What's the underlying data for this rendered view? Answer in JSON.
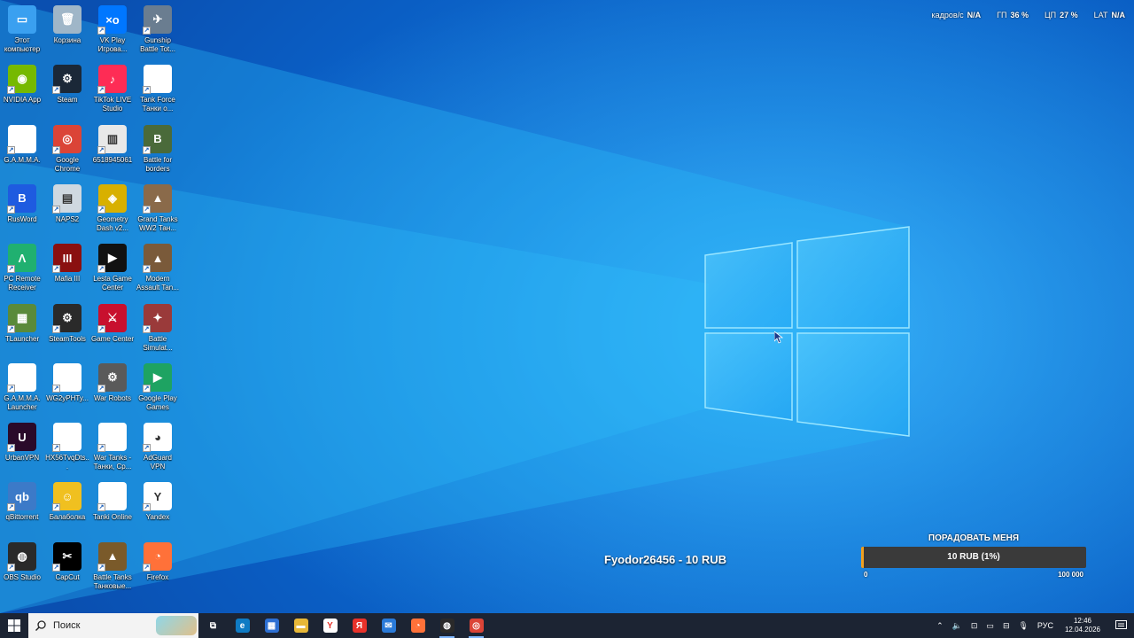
{
  "desktop": {
    "icons": [
      {
        "label": "Этот компьютер",
        "icon": "this-pc-icon",
        "color": "#3aa0f0",
        "glyph": "▭"
      },
      {
        "label": "Корзина",
        "icon": "recycle-bin-icon",
        "color": "#9fb6c8",
        "glyph": "🗑"
      },
      {
        "label": "VK Play Игрова...",
        "icon": "vk-play-icon",
        "color": "#0077ff",
        "glyph": "×o"
      },
      {
        "label": "Gunship Battle Tot...",
        "icon": "gunship-battle-icon",
        "color": "#6a7d90",
        "glyph": "✈"
      },
      {
        "label": "NVIDIA App",
        "icon": "nvidia-icon",
        "color": "#76b900",
        "glyph": "◉"
      },
      {
        "label": "Steam",
        "icon": "steam-icon",
        "color": "#1b2838",
        "glyph": "⚙"
      },
      {
        "label": "TikTok LIVE Studio",
        "icon": "tiktok-icon",
        "color": "#fe2c55",
        "glyph": "♪"
      },
      {
        "label": "Tank Force Танки о...",
        "icon": "file-icon",
        "color": "#ffffff",
        "glyph": ""
      },
      {
        "label": "G.A.M.M.A.",
        "icon": "file-icon",
        "color": "#ffffff",
        "glyph": ""
      },
      {
        "label": "Google Chrome",
        "icon": "chrome-icon",
        "color": "#db4437",
        "glyph": "◎"
      },
      {
        "label": "6518945061",
        "icon": "app-icon",
        "color": "#e8e8e8",
        "glyph": "▥"
      },
      {
        "label": "Battle for borders",
        "icon": "battle-borders-icon",
        "color": "#4a6a3a",
        "glyph": "B"
      },
      {
        "label": "RusWord",
        "icon": "rusword-icon",
        "color": "#1e5be0",
        "glyph": "B"
      },
      {
        "label": "NAPS2",
        "icon": "naps2-icon",
        "color": "#cfd8e0",
        "glyph": "▤"
      },
      {
        "label": "Geometry Dash v2...",
        "icon": "geometry-dash-icon",
        "color": "#d8b000",
        "glyph": "◈"
      },
      {
        "label": "Grand Tanks WW2 Тан...",
        "icon": "grand-tanks-icon",
        "color": "#8a6a4a",
        "glyph": "▲"
      },
      {
        "label": "PC Remote Receiver",
        "icon": "pc-remote-icon",
        "color": "#20b070",
        "glyph": "Λ"
      },
      {
        "label": "Mafia III",
        "icon": "mafia-icon",
        "color": "#8a1010",
        "glyph": "III"
      },
      {
        "label": "Lesta Game Center",
        "icon": "lesta-icon",
        "color": "#111111",
        "glyph": "▶"
      },
      {
        "label": "Modern Assault Tan...",
        "icon": "modern-assault-icon",
        "color": "#7a5a3a",
        "glyph": "▲"
      },
      {
        "label": "TLauncher",
        "icon": "tlauncher-icon",
        "color": "#5a8a3a",
        "glyph": "▦"
      },
      {
        "label": "SteamTools",
        "icon": "steamtools-icon",
        "color": "#2a2a2a",
        "glyph": "⚙"
      },
      {
        "label": "Game Center",
        "icon": "game-center-icon",
        "color": "#c8102e",
        "glyph": "⚔"
      },
      {
        "label": "Battle Simulat...",
        "icon": "battle-simulator-icon",
        "color": "#9a3a3a",
        "glyph": "✦"
      },
      {
        "label": "G.A.M.M.A. Launcher",
        "icon": "file-icon",
        "color": "#ffffff",
        "glyph": ""
      },
      {
        "label": "WG2yPHTy...",
        "icon": "file-icon",
        "color": "#ffffff",
        "glyph": ""
      },
      {
        "label": "War Robots",
        "icon": "war-robots-icon",
        "color": "#5a5a5a",
        "glyph": "⚙"
      },
      {
        "label": "Google Play Games",
        "icon": "google-play-games-icon",
        "color": "#1ea362",
        "glyph": "▶"
      },
      {
        "label": "UrbanVPN",
        "icon": "urbanvpn-icon",
        "color": "#2a0a2a",
        "glyph": "U"
      },
      {
        "label": "HX56TvqDts...",
        "icon": "file-icon",
        "color": "#ffffff",
        "glyph": ""
      },
      {
        "label": "War Tanks - Танки, Сp...",
        "icon": "file-icon",
        "color": "#ffffff",
        "glyph": ""
      },
      {
        "label": "AdGuard VPN",
        "icon": "adguard-vpn-icon",
        "color": "#ffffff",
        "glyph": "◕"
      },
      {
        "label": "qBittorrent",
        "icon": "qbittorrent-icon",
        "color": "#3c7ac8",
        "glyph": "qb"
      },
      {
        "label": "Балаболка",
        "icon": "balabolka-icon",
        "color": "#f0c020",
        "glyph": "☺"
      },
      {
        "label": "Tanki Online",
        "icon": "file-icon",
        "color": "#ffffff",
        "glyph": ""
      },
      {
        "label": "Yandex",
        "icon": "yandex-icon",
        "color": "#ffffff",
        "glyph": "Y"
      },
      {
        "label": "OBS Studio",
        "icon": "obs-icon",
        "color": "#2a2a2a",
        "glyph": "◍"
      },
      {
        "label": "CapCut",
        "icon": "capcut-icon",
        "color": "#000000",
        "glyph": "✂"
      },
      {
        "label": "Battle Tanks Танковые...",
        "icon": "battle-tanks-icon",
        "color": "#7a5a2a",
        "glyph": "▲"
      },
      {
        "label": "Firefox",
        "icon": "firefox-icon",
        "color": "#ff7139",
        "glyph": "◔"
      }
    ]
  },
  "hud": {
    "fps_label": "кадров/с",
    "fps_value": "N/A",
    "gpu_label": "ГП",
    "gpu_value": "36 %",
    "cpu_label": "ЦП",
    "cpu_value": "27 %",
    "lat_label": "LAT",
    "lat_value": "N/A"
  },
  "donation": {
    "text": "Fyodor26456 - 10 RUB"
  },
  "goal": {
    "title": "ПОРАДОВАТЬ МЕНЯ",
    "bar_text": "10 RUB (1%)",
    "progress_percent": 1,
    "min_label": "0",
    "max_label": "100 000",
    "fill_color": "#f0a020"
  },
  "taskbar": {
    "search_placeholder": "Поиск",
    "apps": [
      {
        "name": "task-view-icon",
        "glyph": "⧉",
        "color": "transparent"
      },
      {
        "name": "edge-icon",
        "glyph": "e",
        "color": "#0f7bc4"
      },
      {
        "name": "store-icon",
        "glyph": "▦",
        "color": "#2d6fd2"
      },
      {
        "name": "file-explorer-icon",
        "glyph": "▬",
        "color": "#e8b838"
      },
      {
        "name": "yandex-browser-icon",
        "glyph": "Y",
        "color": "#ffffff"
      },
      {
        "name": "yandex-icon",
        "glyph": "Я",
        "color": "#e8322a"
      },
      {
        "name": "mail-icon",
        "glyph": "✉",
        "color": "#2a7ad8"
      },
      {
        "name": "firefox-icon",
        "glyph": "◔",
        "color": "#ff7139"
      },
      {
        "name": "obs-icon",
        "glyph": "◍",
        "color": "#2a2a2a"
      },
      {
        "name": "chrome-icon",
        "glyph": "◎",
        "color": "#db4437"
      }
    ],
    "active_apps": [
      8,
      9
    ],
    "language": "РУС",
    "time": "12:46",
    "date": "12.04.2026"
  }
}
